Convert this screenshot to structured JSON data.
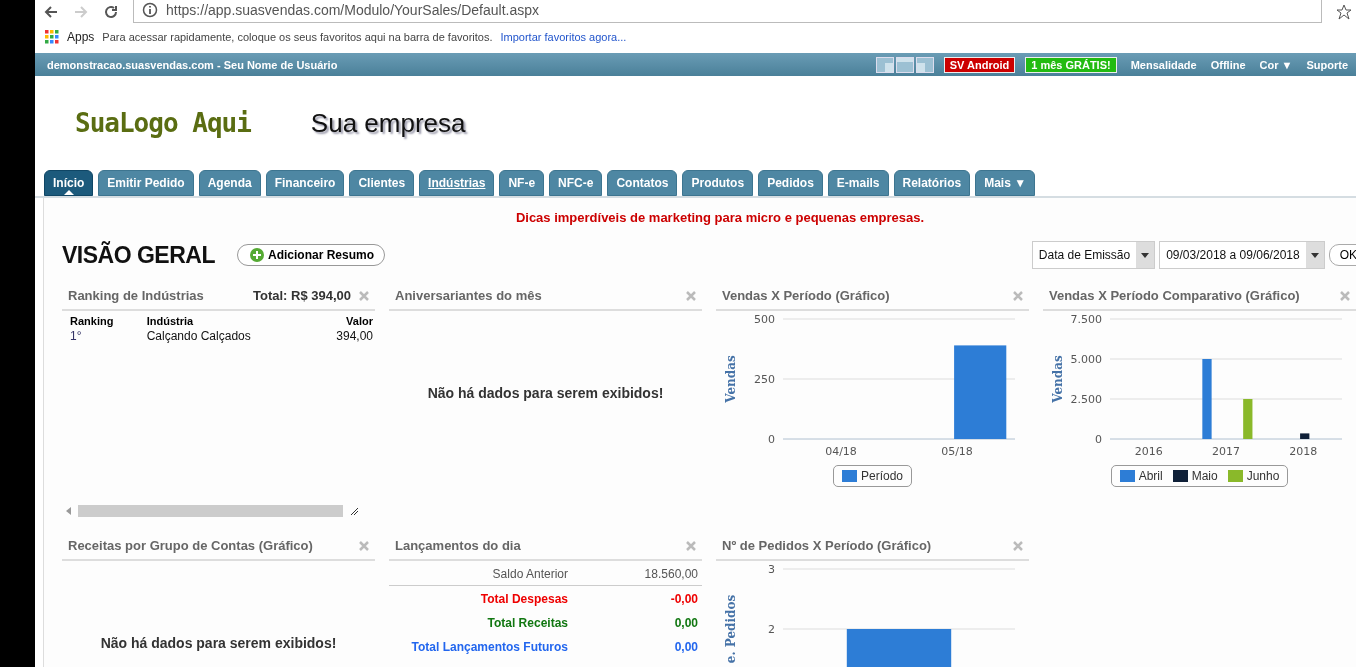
{
  "browser": {
    "url": "https://app.suasvendas.com/Modulo/YourSales/Default.aspx",
    "back_disabled": false,
    "forward_disabled": true,
    "bookmarks": {
      "apps": "Apps",
      "message": "Para acessar rapidamente, coloque os seus favoritos aqui na barra de favoritos.",
      "link": "Importar favoritos agora..."
    }
  },
  "header": {
    "site": "demonstracao.suasvendas.com - Seu Nome de Usuário",
    "badges": [
      {
        "label": "SV Android",
        "color": "#cc0000"
      },
      {
        "label": "1 mês GRÁTIS!",
        "color": "#22bb11"
      }
    ],
    "links": [
      "Mensalidade",
      "Offline",
      "Cor ▼",
      "Suporte"
    ]
  },
  "brand": {
    "logo": "SuaLogo Aqui",
    "company": "Sua empresa"
  },
  "tabs": [
    {
      "label": "Início",
      "selected": true,
      "hovered": false
    },
    {
      "label": "Emitir Pedido",
      "selected": false,
      "hovered": false
    },
    {
      "label": "Agenda",
      "selected": false,
      "hovered": false
    },
    {
      "label": "Financeiro",
      "selected": false,
      "hovered": false
    },
    {
      "label": "Clientes",
      "selected": false,
      "hovered": false
    },
    {
      "label": "Indústrias",
      "selected": false,
      "hovered": true
    },
    {
      "label": "NF-e",
      "selected": false,
      "hovered": false
    },
    {
      "label": "NFC-e",
      "selected": false,
      "hovered": false
    },
    {
      "label": "Contatos",
      "selected": false,
      "hovered": false
    },
    {
      "label": "Produtos",
      "selected": false,
      "hovered": false
    },
    {
      "label": "Pedidos",
      "selected": false,
      "hovered": false
    },
    {
      "label": "E-mails",
      "selected": false,
      "hovered": false
    },
    {
      "label": "Relatórios",
      "selected": false,
      "hovered": false
    },
    {
      "label": "Mais ▼",
      "selected": false,
      "hovered": false
    }
  ],
  "tip": "Dicas imperdíveis de marketing para micro e pequenas empresas.",
  "overview": {
    "title": "VISÃO GERAL",
    "add_button": "Adicionar Resumo",
    "date_type": "Data de Emissão",
    "date_range": "09/03/2018 a 09/06/2018",
    "ok": "OK"
  },
  "widgets": [
    {
      "kind": "ranking",
      "title": "Ranking de Indústrias",
      "total": "Total: R$ 394,00",
      "columns": [
        "Ranking",
        "Indústria",
        "Valor"
      ],
      "rows": [
        [
          "1°",
          "Calçando Calçados",
          "394,00"
        ]
      ]
    },
    {
      "kind": "empty",
      "title": "Aniversariantes do mês",
      "message": "Não há dados para serem exibidos!"
    },
    {
      "kind": "chart",
      "title": "Vendas X Período (Gráfico)",
      "chart_data": {
        "type": "bar",
        "ylabel": "Vendas",
        "categories": [
          "04/18",
          "05/18"
        ],
        "series": [
          {
            "name": "Período",
            "color": "#2d7dd6",
            "values": [
              0,
              390
            ]
          }
        ],
        "yticks": [
          0,
          250,
          500
        ],
        "ylim": [
          0,
          500
        ]
      }
    },
    {
      "kind": "chart",
      "title": "Vendas X Período Comparativo (Gráfico)",
      "chart_data": {
        "type": "bar",
        "ylabel": "Vendas",
        "categories": [
          "2016",
          "2017",
          "2018"
        ],
        "series": [
          {
            "name": "Abril",
            "color": "#2d7dd6",
            "values": [
              0,
              5000,
              0
            ]
          },
          {
            "name": "Maio",
            "color": "#0f2038",
            "values": [
              0,
              0,
              350
            ]
          },
          {
            "name": "Junho",
            "color": "#8ab92a",
            "values": [
              0,
              2500,
              0
            ]
          }
        ],
        "yticks": [
          0,
          {
            "value": 2500,
            "label": "2.500"
          },
          {
            "value": 5000,
            "label": "5.000"
          },
          {
            "value": 7500,
            "label": "7.500"
          }
        ],
        "ylim": [
          0,
          7500
        ]
      }
    },
    {
      "kind": "empty",
      "title": "Receitas por Grupo de Contas (Gráfico)",
      "message": "Não há dados para serem exibidos!"
    },
    {
      "kind": "entries",
      "title": "Lançamentos do dia",
      "rows": [
        {
          "label": "Saldo Anterior",
          "value": "18.560,00",
          "color": "#555555"
        },
        {
          "label": "Total Despesas",
          "value": "-0,00",
          "color": "#ee0000"
        },
        {
          "label": "Total Receitas",
          "value": "0,00",
          "color": "#117711"
        },
        {
          "label": "Total Lançamentos Futuros",
          "value": "0,00",
          "color": "#2266ee"
        }
      ]
    },
    {
      "kind": "chart",
      "title": "Nº de Pedidos X Período (Gráfico)",
      "chart_data": {
        "type": "bar",
        "ylabel": "e. Pedidos",
        "series": [
          {
            "color": "#2d7dd6",
            "values": [
              2
            ]
          }
        ],
        "yticks": [
          2,
          3
        ],
        "ylim": [
          1,
          3
        ]
      }
    }
  ]
}
